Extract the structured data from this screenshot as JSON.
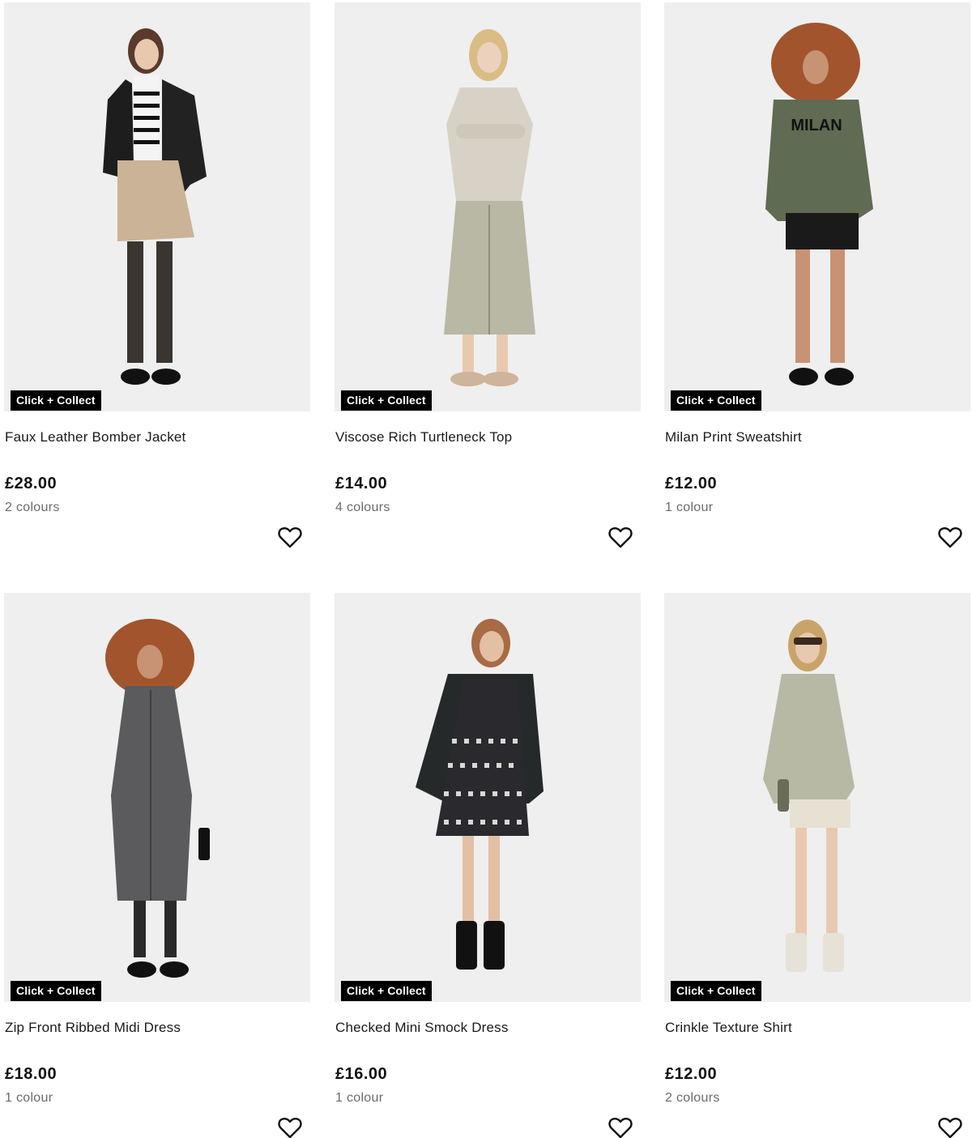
{
  "products": [
    {
      "badge": "Click + Collect",
      "name": "Faux Leather Bomber Jacket",
      "price": "£28.00",
      "colours": "2 colours"
    },
    {
      "badge": "Click + Collect",
      "name": "Viscose Rich Turtleneck Top",
      "price": "£14.00",
      "colours": "4 colours"
    },
    {
      "badge": "Click + Collect",
      "name": "Milan Print Sweatshirt",
      "price": "£12.00",
      "colours": "1 colour",
      "print_text": "MILAN"
    },
    {
      "badge": "Click + Collect",
      "name": "Zip Front Ribbed Midi Dress",
      "price": "£18.00",
      "colours": "1 colour"
    },
    {
      "badge": "Click + Collect",
      "name": "Checked Mini Smock Dress",
      "price": "£16.00",
      "colours": "1 colour"
    },
    {
      "badge": "Click + Collect",
      "name": "Crinkle Texture Shirt",
      "price": "£12.00",
      "colours": "2 colours"
    }
  ],
  "icons": {
    "wishlist": "heart-outline-icon"
  },
  "colors": {
    "badge_bg": "#000000",
    "badge_text": "#ffffff",
    "image_bg": "#efefef",
    "muted_text": "#6b6b6b"
  }
}
